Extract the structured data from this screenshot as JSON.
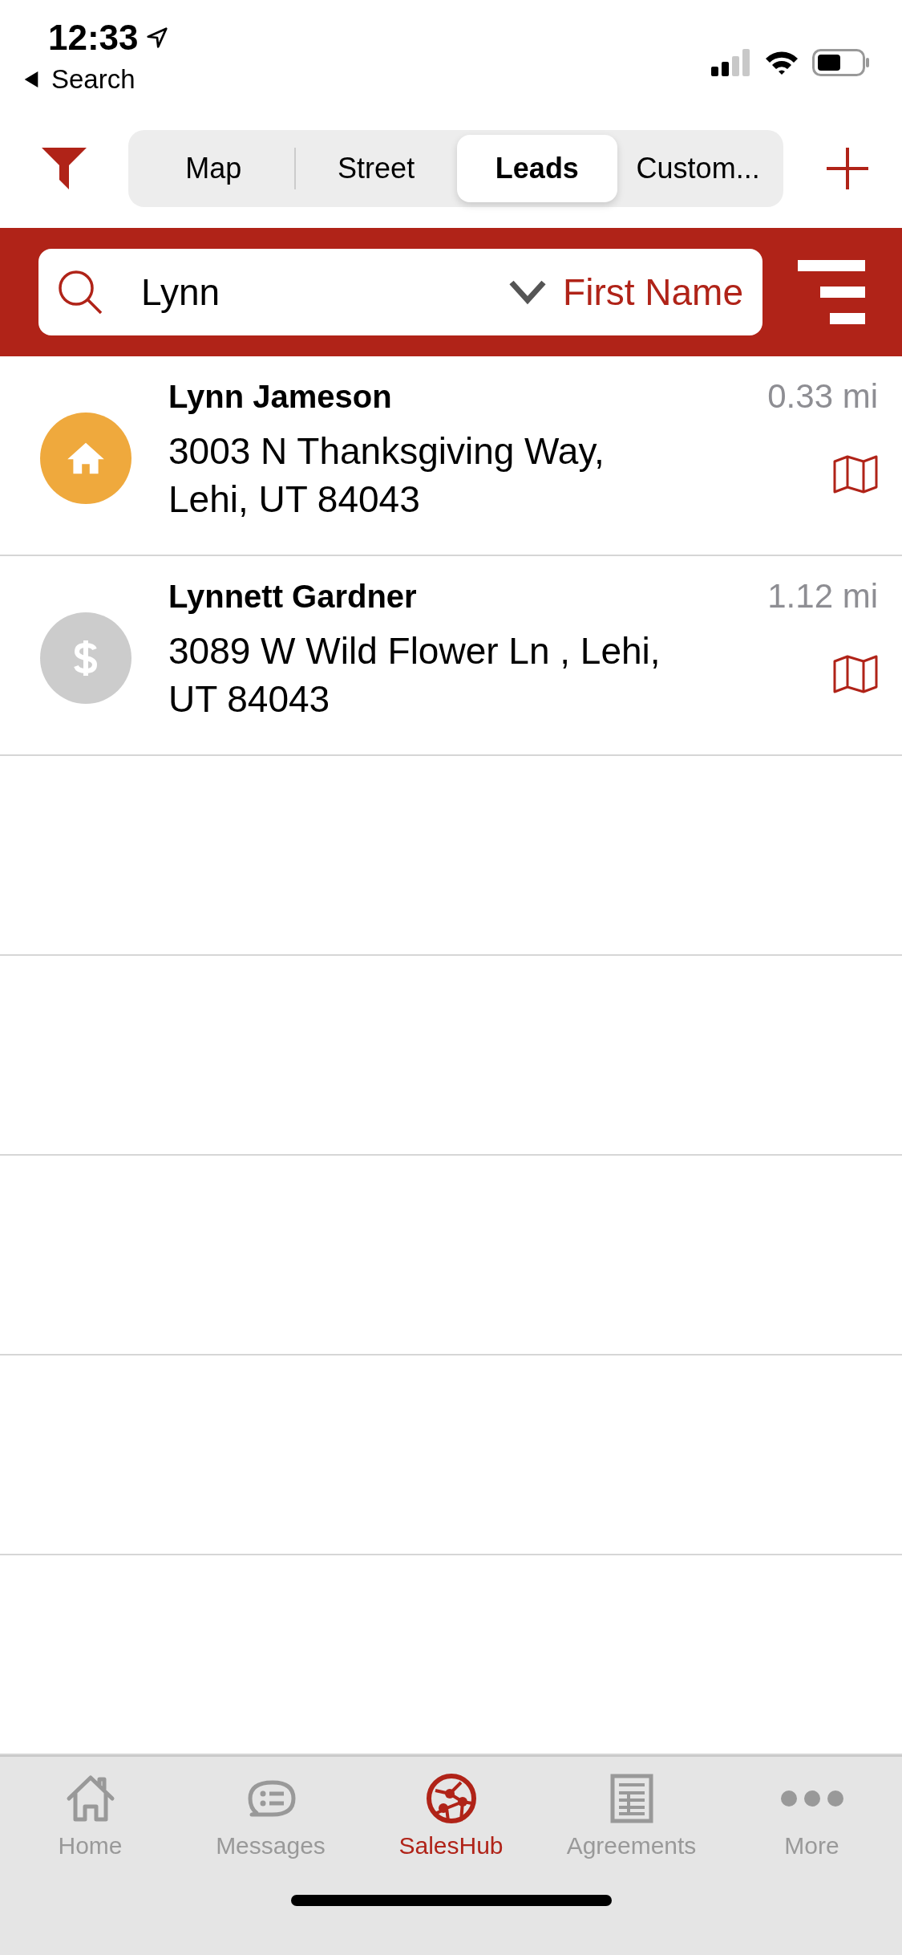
{
  "status_bar": {
    "time": "12:33",
    "back_label": "Search"
  },
  "segments": [
    {
      "label": "Map",
      "selected": false
    },
    {
      "label": "Street",
      "selected": false
    },
    {
      "label": "Leads",
      "selected": true
    },
    {
      "label": "Custom...",
      "selected": false
    }
  ],
  "search": {
    "value": "Lynn",
    "field_label": "First Name"
  },
  "leads": [
    {
      "kind": "home",
      "color": "#efa93d",
      "name": "Lynn Jameson",
      "distance": "0.33 mi",
      "address": "3003 N Thanksgiving Way, Lehi, UT 84043"
    },
    {
      "kind": "dollar",
      "color": "#cccccc",
      "name": "Lynnett Gardner",
      "distance": "1.12 mi",
      "address": "3089 W Wild Flower Ln , Lehi, UT 84043"
    }
  ],
  "tab_bar": [
    {
      "kind": "home",
      "label": "Home",
      "selected": false
    },
    {
      "kind": "messages",
      "label": "Messages",
      "selected": false
    },
    {
      "kind": "hub",
      "label": "SalesHub",
      "selected": true
    },
    {
      "kind": "agreements",
      "label": "Agreements",
      "selected": false
    },
    {
      "kind": "more",
      "label": "More",
      "selected": false
    }
  ]
}
